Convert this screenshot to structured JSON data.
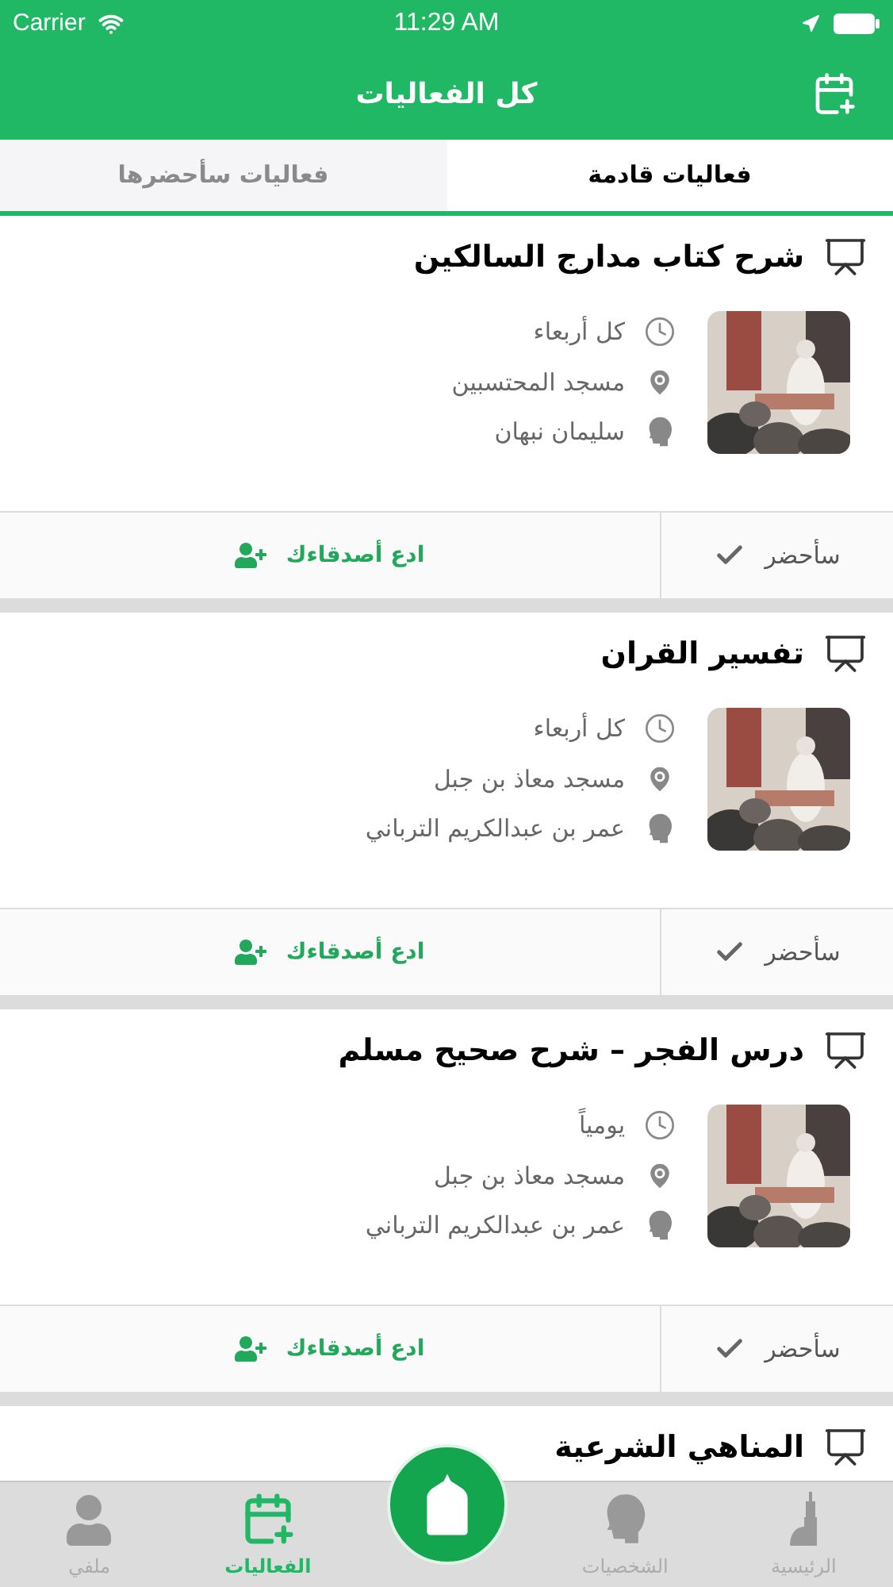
{
  "status_bar": {
    "carrier": "Carrier",
    "time": "11:29 AM"
  },
  "nav_bar": {
    "title": "كل الفعاليات"
  },
  "tabs": [
    {
      "label": "فعاليات قادمة",
      "selected": true
    },
    {
      "label": "فعاليات سأحضرها",
      "selected": false
    }
  ],
  "events": [
    {
      "title": "شرح كتاب مدارج السالكين",
      "schedule": "كل أربعاء",
      "place": "مسجد المحتسبين",
      "speaker": "سليمان نبهان",
      "attend_label": "سأحضر",
      "invite_label": "ادع أصدقاءك"
    },
    {
      "title": "تفسير القران",
      "schedule": "كل أربعاء",
      "place": "مسجد معاذ بن جبل",
      "speaker": "عمر بن عبدالكريم الترباني",
      "attend_label": "سأحضر",
      "invite_label": "ادع أصدقاءك"
    },
    {
      "title": "درس الفجر – شرح صحيح مسلم",
      "schedule": "يومياً",
      "place": "مسجد معاذ بن جبل",
      "speaker": "عمر بن عبدالكريم الترباني",
      "attend_label": "سأحضر",
      "invite_label": "ادع أصدقاءك"
    },
    {
      "title": "المناهي الشرعية"
    }
  ],
  "tab_bar": [
    {
      "kind": "home",
      "label": "الرئيسية",
      "selected": false
    },
    {
      "kind": "people",
      "label": "الشخصيات",
      "selected": false
    },
    {
      "kind": "center"
    },
    {
      "kind": "events",
      "label": "الفعاليات",
      "selected": true
    },
    {
      "kind": "profile",
      "label": "ملفي",
      "selected": false
    }
  ]
}
